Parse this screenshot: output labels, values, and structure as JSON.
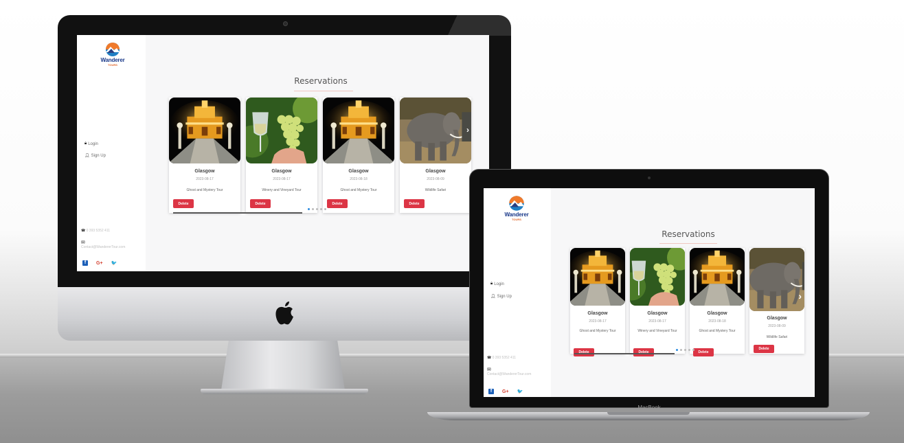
{
  "brand": {
    "name": "Wanderer",
    "tagline": "TOURS"
  },
  "nav": {
    "login": "Login",
    "signup": "Sign Up"
  },
  "contact": {
    "phone": "0 393 5352 411",
    "email": "Contact@WandererTour.com"
  },
  "social": {
    "facebook": "f",
    "google": "G+",
    "twitter": "🐦"
  },
  "page": {
    "title": "Reservations"
  },
  "reservations": [
    {
      "city": "Glasgow",
      "date": "2023-08-17",
      "tour": "Ghost and Mystery Tour",
      "image": "castle-night"
    },
    {
      "city": "Glasgow",
      "date": "2023-08-17",
      "tour": "Winery and Vineyard Tour",
      "image": "grapes-wine"
    },
    {
      "city": "Glasgow",
      "date": "2023-08-18",
      "tour": "Ghost and Mystery Tour",
      "image": "castle-night"
    },
    {
      "city": "Glasgow",
      "date": "2023-08-09",
      "tour": "Wildlife Safari",
      "image": "elephant"
    }
  ],
  "delete_label": "Delete",
  "device_label": "MacBook",
  "colors": {
    "delete": "#dc3545",
    "brand": "#1b3a8a",
    "accent": "#e0662a",
    "active_dot": "#2b8be0"
  }
}
